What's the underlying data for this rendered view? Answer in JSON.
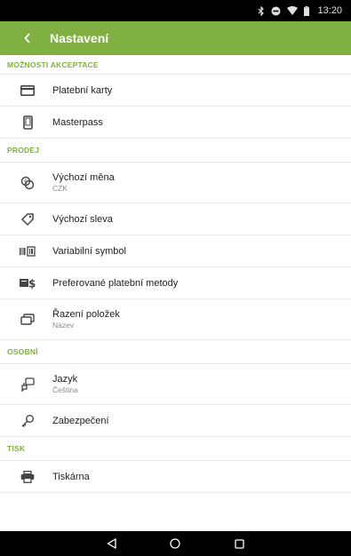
{
  "status_bar": {
    "time": "13:20"
  },
  "app_bar": {
    "title": "Nastavení"
  },
  "sections": {
    "acceptance": {
      "title": "MOŽNOSTI AKCEPTACE",
      "items": [
        {
          "label": "Platební karty",
          "icon": "credit-card-icon"
        },
        {
          "label": "Masterpass",
          "icon": "phone-icon"
        }
      ]
    },
    "sales": {
      "title": "PRODEJ",
      "items": [
        {
          "label": "Výchozí měna",
          "sub": "CZK",
          "icon": "currency-exchange-icon"
        },
        {
          "label": "Výchozí sleva",
          "icon": "tag-icon"
        },
        {
          "label": "Variabilní symbol",
          "icon": "barcode-icon"
        },
        {
          "label": "Preferované platební metody",
          "icon": "cash-dollar-icon"
        },
        {
          "label": "Řazení položek",
          "sub": "Název",
          "icon": "sort-layers-icon"
        }
      ]
    },
    "personal": {
      "title": "OSOBNÍ",
      "items": [
        {
          "label": "Jazyk",
          "sub": "Čeština",
          "icon": "language-icon"
        },
        {
          "label": "Zabezpečení",
          "icon": "key-icon"
        }
      ]
    },
    "print": {
      "title": "TISK",
      "items": [
        {
          "label": "Tiskárna",
          "icon": "printer-icon"
        }
      ]
    }
  },
  "colors": {
    "accent": "#7fb041",
    "status_bar": "#000000",
    "nav_bar": "#000000"
  }
}
